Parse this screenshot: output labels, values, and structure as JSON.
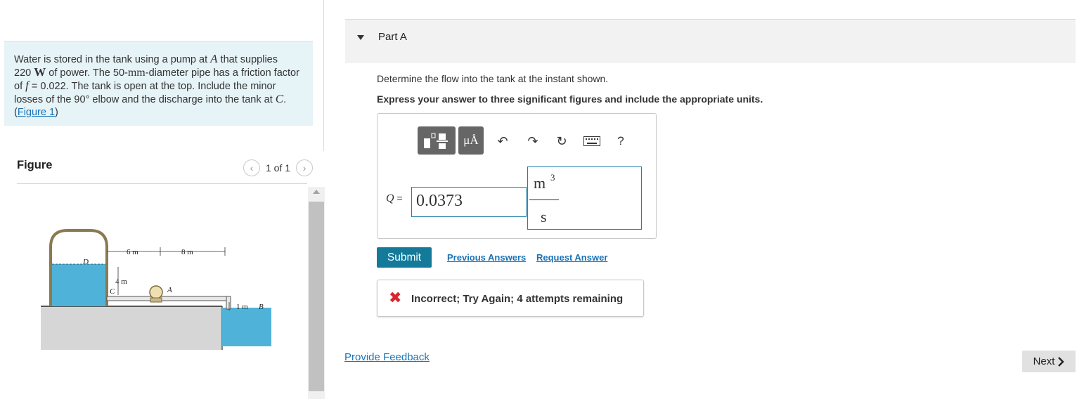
{
  "problem": {
    "text_1": "Water is stored in the tank using a pump at ",
    "pump_point": "A",
    "text_2": " that supplies",
    "power_value": "220 ",
    "power_unit": "W",
    "text_3": " of power. The 50-",
    "diameter_unit": "mm",
    "text_4": "-diameter pipe has a friction factor of ",
    "friction_symbol": "f",
    "text_5": " = 0.022. The tank is open at the top. Include the minor losses of the 90° elbow and the discharge into the tank at ",
    "discharge_point": "C",
    "text_6": ". (",
    "figure_link": "Figure 1",
    "text_7": ")"
  },
  "figure": {
    "heading": "Figure",
    "counter": "1 of 1",
    "prev_icon": "chevron-left-icon",
    "next_icon": "chevron-right-icon",
    "labels": {
      "d": "D",
      "dim_6m": "6 m",
      "dim_8m": "8 m",
      "dim_4m": "4 m",
      "c": "C",
      "a": "A",
      "dim_1m": "1 m",
      "b": "B"
    },
    "colors": {
      "water": "#4fb3d9",
      "ground": "#d3d3d3",
      "tank": "#f0dfb0"
    }
  },
  "part": {
    "title": "Part A",
    "question": "Determine the flow into the tank at the instant shown.",
    "instruction": "Express your answer to three significant figures and include the appropriate units.",
    "toolbar": {
      "units_label": "μÅ",
      "help_label": "?",
      "icons": [
        "templates-icon",
        "units-icon",
        "undo-icon",
        "redo-icon",
        "reset-icon",
        "keyboard-icon",
        "help-icon"
      ]
    },
    "answer": {
      "variable": "Q",
      "equals": " =",
      "value": "0.0373",
      "unit_numerator": "m",
      "unit_exponent": "3",
      "unit_denominator": "s"
    },
    "submit_label": "Submit",
    "previous_answers": "Previous Answers",
    "request_answer": "Request Answer",
    "feedback": {
      "icon": "x-icon",
      "text": "Incorrect; Try Again; 4 attempts remaining"
    }
  },
  "footer": {
    "provide_feedback": "Provide Feedback",
    "next_label": "Next",
    "next_icon": "chevron-right-icon"
  },
  "colors": {
    "accent": "#137a9a",
    "link": "#1a73b5",
    "error": "#d9252c",
    "problem_bg": "#e6f3f7"
  }
}
